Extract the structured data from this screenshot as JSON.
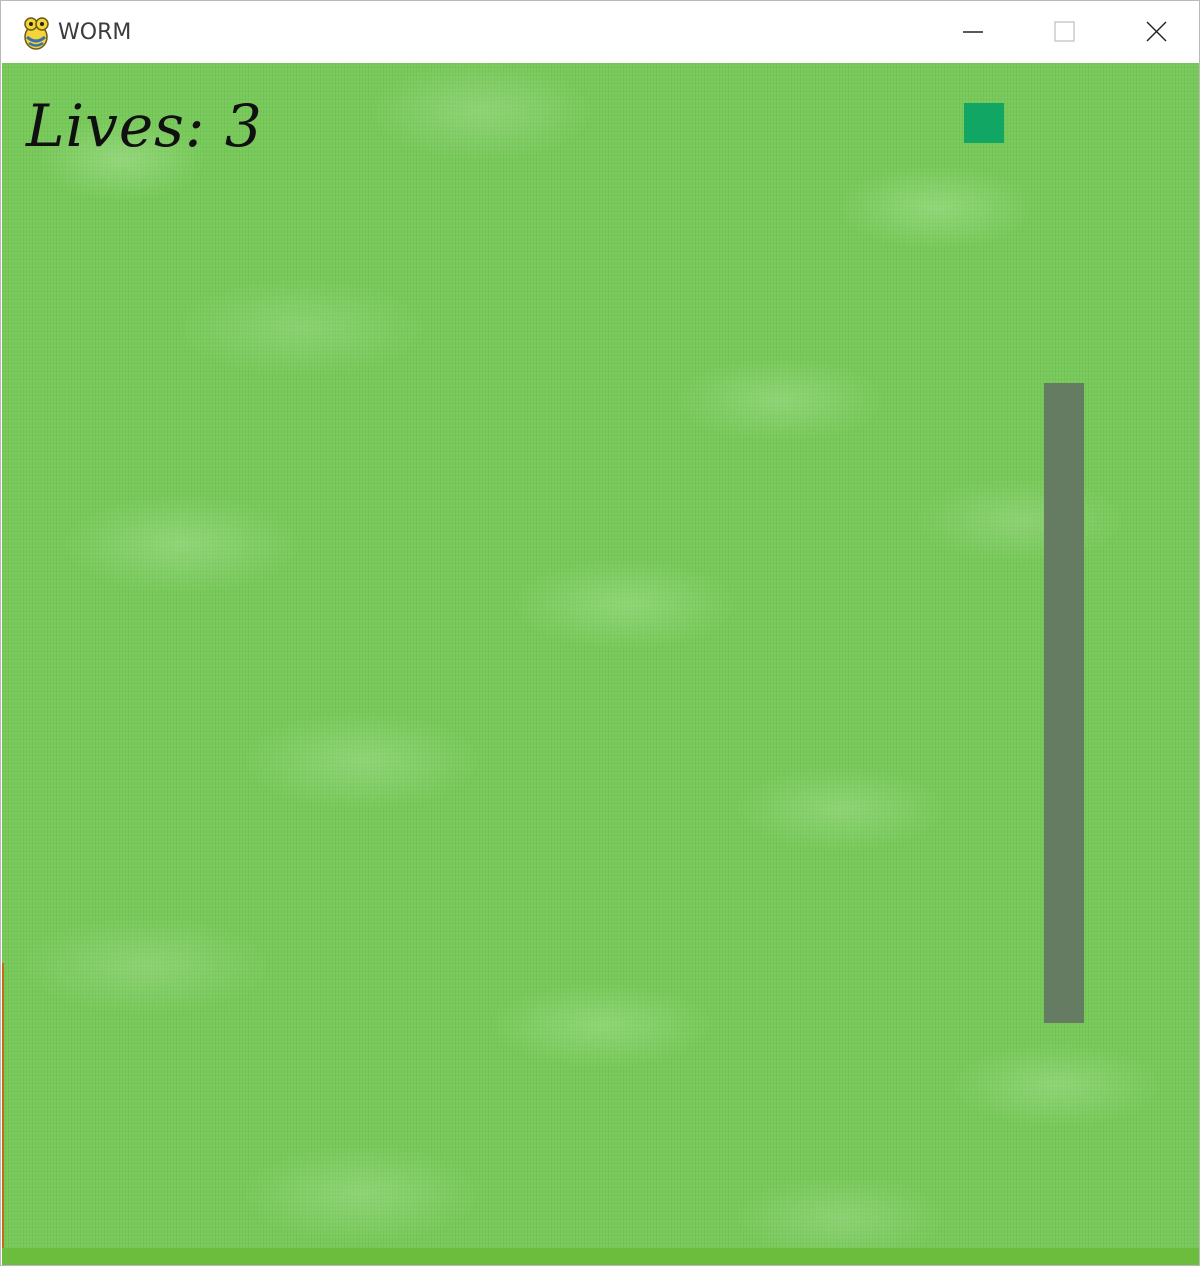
{
  "window": {
    "title": "WORM",
    "app_icon": "pygame-snake-icon",
    "controls": {
      "minimize_icon": "minimize-icon",
      "maximize_icon": "maximize-icon",
      "close_icon": "close-icon"
    }
  },
  "game": {
    "lives_label": "Lives: 3",
    "lives": 3,
    "colors": {
      "background": "#78c95a",
      "food": "#12a664",
      "worm": "#667c62",
      "text": "#101010"
    },
    "worm_direction": "vertical"
  }
}
